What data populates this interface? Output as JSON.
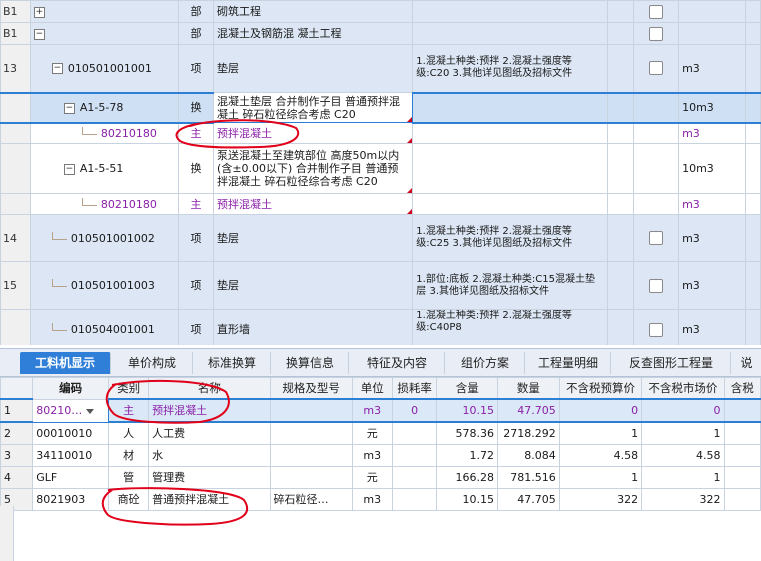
{
  "upper_rows": [
    {
      "num": "B1",
      "toggle": "+",
      "code": "",
      "type": "部",
      "name": "砌筑工程",
      "features": "",
      "unit": "",
      "style": "blue"
    },
    {
      "num": "B1",
      "toggle": "−",
      "code": "",
      "type": "部",
      "name": "混凝土及钢筋混  凝土工程",
      "features": "",
      "unit": "",
      "style": "blue"
    },
    {
      "num": "13",
      "toggle": "−",
      "code": "010501001001",
      "type": "项",
      "name": "垫层",
      "features": "1.混凝土种类:预拌\n2.混凝土强度等级:C20\n3.其他详见图纸及招标文件",
      "unit": "m3",
      "style": "blue"
    },
    {
      "num": "",
      "toggle": "−",
      "code": "A1-5-78",
      "type": "换",
      "name": "混凝土垫层  合并制作子目 普通预拌混凝土 碎石粒径综合考虑 C20",
      "features": "",
      "unit": "10m3",
      "style": "sel"
    },
    {
      "num": "",
      "toggle": "",
      "code": "80210180",
      "type": "主",
      "name": "预拌混凝土",
      "features": "",
      "unit": "m3",
      "style": "white"
    },
    {
      "num": "",
      "toggle": "−",
      "code": "A1-5-51",
      "type": "换",
      "name": "泵送混凝土至建筑部位 高度50m以内(含±0.00以下)  合并制作子目  普通预拌混凝土  碎石粒径综合考虑 C20",
      "features": "",
      "unit": "10m3",
      "style": "white"
    },
    {
      "num": "",
      "toggle": "",
      "code": "80210180",
      "type": "主",
      "name": "预拌混凝土",
      "features": "",
      "unit": "m3",
      "style": "white"
    },
    {
      "num": "14",
      "toggle": "",
      "code": "010501001002",
      "type": "项",
      "name": "垫层",
      "features": "1.混凝土种类:预拌\n2.混凝土强度等级:C25\n3.其他详见图纸及招标文件",
      "unit": "m3",
      "style": "blue"
    },
    {
      "num": "15",
      "toggle": "",
      "code": "010501001003",
      "type": "项",
      "name": "垫层",
      "features": "1.部位:底板\n2.混凝土种类:C15混凝土垫层\n3.其他详见图纸及招标文件",
      "unit": "m3",
      "style": "blue"
    },
    {
      "num": "",
      "toggle": "",
      "code": "010504001001",
      "type": "项",
      "name": "直形墙",
      "features": "1.混凝土种类:预拌\n2.混凝土强度等级:C40P8",
      "unit": "m3",
      "style": "blue"
    }
  ],
  "tabs": [
    "工料机显示",
    "单价构成",
    "标准换算",
    "换算信息",
    "特征及内容",
    "组价方案",
    "工程量明细",
    "反查图形工程量",
    "说"
  ],
  "lower_headers": [
    "",
    "编码",
    "类别",
    "名称",
    "规格及型号",
    "单位",
    "损耗率",
    "含量",
    "数量",
    "不含税预算价",
    "不含税市场价",
    "含税"
  ],
  "lower_rows": [
    {
      "num": "1",
      "code": "80210…",
      "cat": "主",
      "name": "预拌混凝土",
      "spec": "",
      "unit": "m3",
      "loss": "0",
      "qty": "10.15",
      "amount": "47.705",
      "pre": "0",
      "mkt": "0"
    },
    {
      "num": "2",
      "code": "00010010",
      "cat": "人",
      "name": "人工费",
      "spec": "",
      "unit": "元",
      "loss": "",
      "qty": "578.36",
      "amount": "2718.292",
      "pre": "1",
      "mkt": "1"
    },
    {
      "num": "3",
      "code": "34110010",
      "cat": "材",
      "name": "水",
      "spec": "",
      "unit": "m3",
      "loss": "",
      "qty": "1.72",
      "amount": "8.084",
      "pre": "4.58",
      "mkt": "4.58"
    },
    {
      "num": "4",
      "code": "GLF",
      "cat": "管",
      "name": "管理费",
      "spec": "",
      "unit": "元",
      "loss": "",
      "qty": "166.28",
      "amount": "781.516",
      "pre": "1",
      "mkt": "1"
    },
    {
      "num": "5",
      "code": "8021903",
      "cat": "商砼",
      "name": "普通预拌混凝土",
      "spec": "碎石粒径…",
      "unit": "m3",
      "loss": "",
      "qty": "10.15",
      "amount": "47.705",
      "pre": "322",
      "mkt": "322"
    }
  ],
  "colors": {
    "accent": "#2f7fd8",
    "purple": "#8a1fa8",
    "annotation": "#e0001a",
    "row_blue": "#dce6f4"
  }
}
